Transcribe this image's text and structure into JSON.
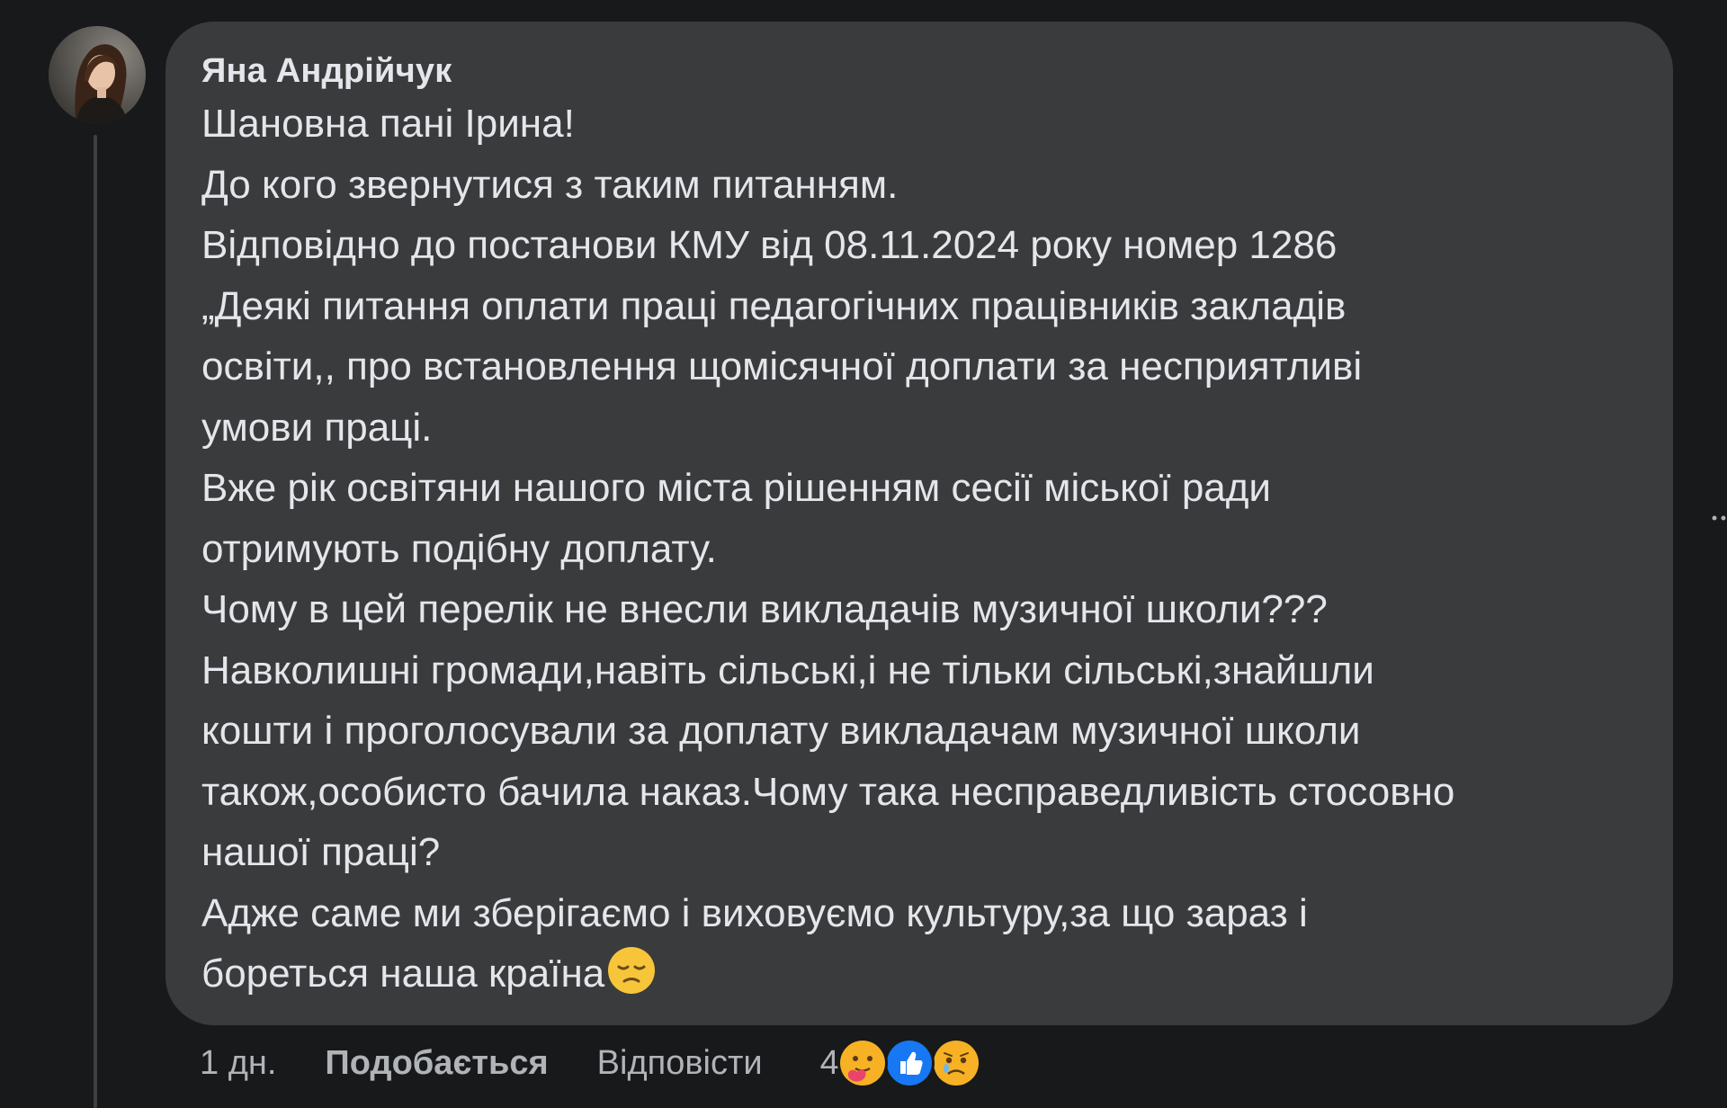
{
  "comment": {
    "author": "Яна Андрійчук",
    "body_lines": [
      "Шановна пані Ірина!",
      "До кого звернутися з таким питанням.",
      "Відповідно до постанови КМУ від 08.11.2024 року номер 1286",
      "„Деякі питання оплати праці педагогічних працівників закладів",
      "освіти,, про встановлення щомісячної доплати за несприятливі",
      "умови праці.",
      "Вже рік освітяни нашого міста рішенням сесії міської ради",
      "отримують подібну доплату.",
      "Чому в цей перелік не внесли викладачів музичної школи???",
      "Навколишні громади,навіть сільські,і не тільки сільські,знайшли",
      "кошти і проголосували за доплату викладачам музичної школи",
      "також,особисто бачила наказ.Чому така несправедливість стосовно",
      "нашої праці?",
      "Адже саме ми зберігаємо і виховуємо культуру,за що зараз і",
      "бореться наша країна"
    ],
    "inline_emoji": "pensive-face-icon"
  },
  "actions": {
    "time": "1 дн.",
    "like_label": "Подобається",
    "reply_label": "Відповісти",
    "reaction_count": "4",
    "reaction_icons": [
      "care-reaction-icon",
      "like-reaction-icon",
      "sad-reaction-icon"
    ]
  },
  "colors": {
    "background": "#18191a",
    "bubble": "#3a3b3c",
    "text": "#e4e6eb",
    "secondary_text": "#b0b3b8",
    "like_blue": "#1877f2",
    "emoji_yellow": "#f7b125"
  }
}
